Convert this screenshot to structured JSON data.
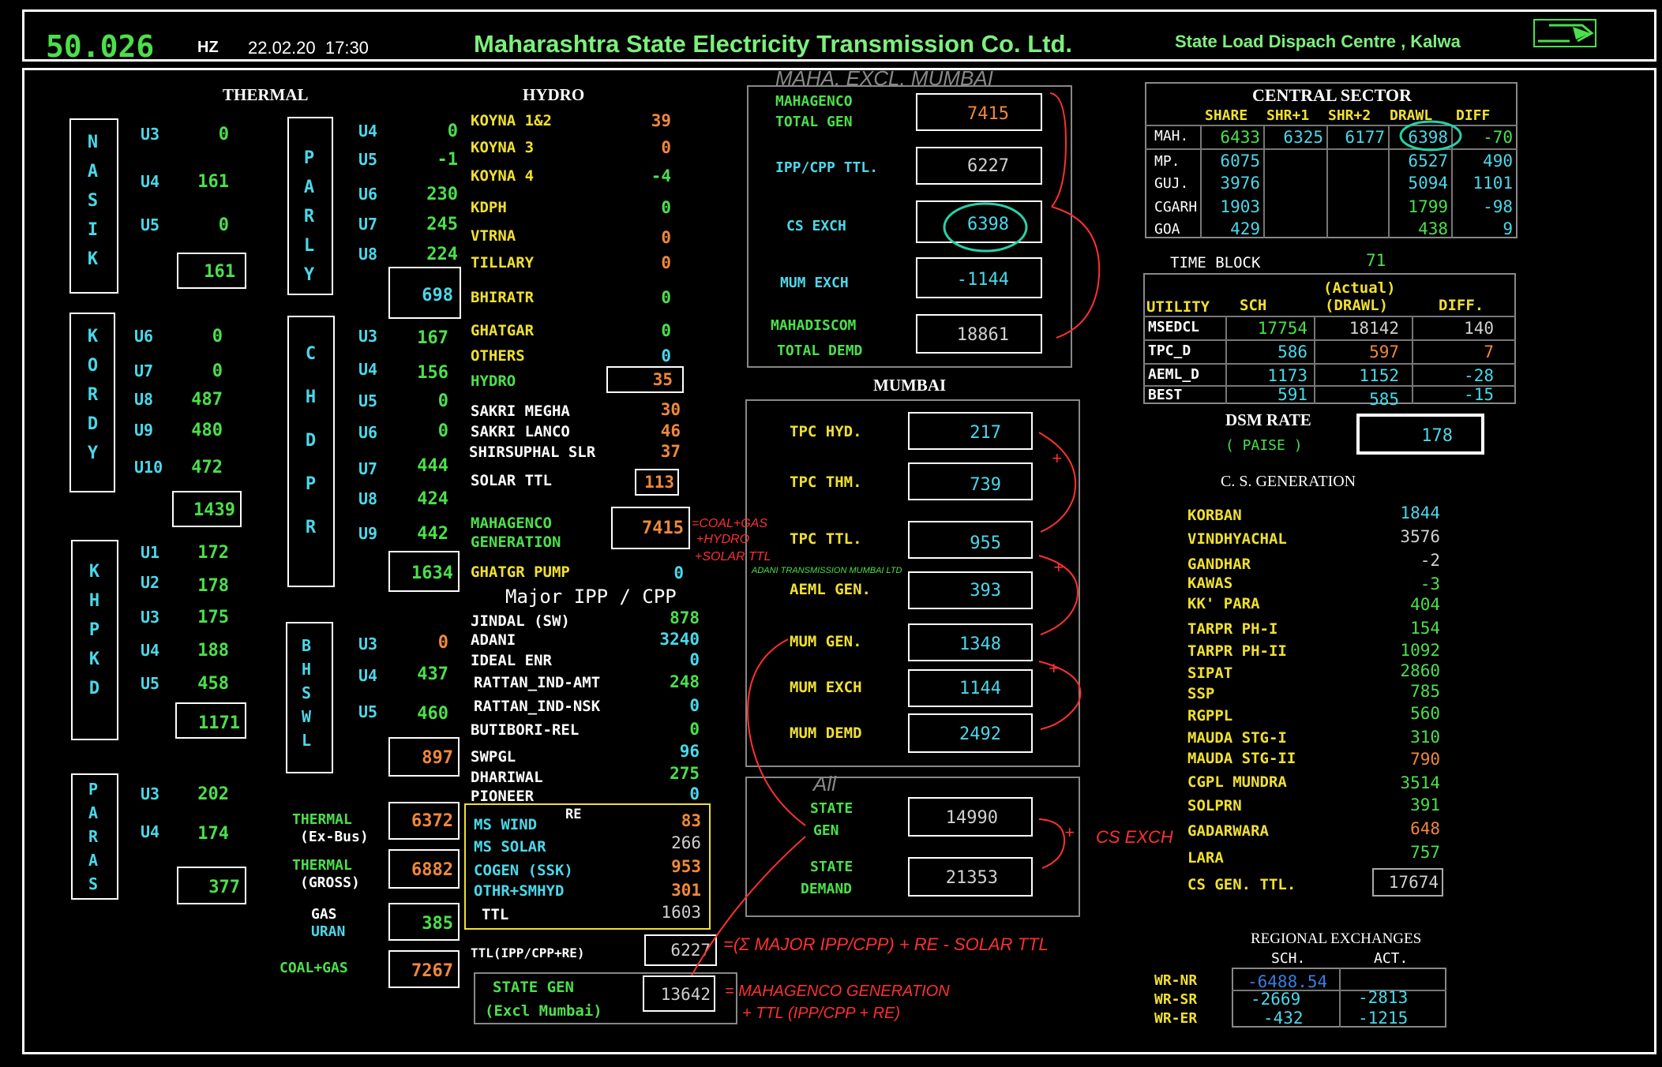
{
  "header": {
    "freq": "50.026",
    "freq_unit": "HZ",
    "datetime": "22.02.20  17:30",
    "company": "Maharashtra State Electricity Transmission Co. Ltd.",
    "centre": "State Load Dispach Centre , Kalwa"
  },
  "thermal": {
    "title": "THERMAL",
    "nasik": {
      "name": "NASIK",
      "units": [
        {
          "u": "U3",
          "v": "0"
        },
        {
          "u": "U4",
          "v": "161"
        },
        {
          "u": "U5",
          "v": "0"
        }
      ],
      "total": "161"
    },
    "koradi": {
      "name": "KORDY",
      "units": [
        {
          "u": "U6",
          "v": "0"
        },
        {
          "u": "U7",
          "v": "0"
        },
        {
          "u": "U8",
          "v": "487"
        },
        {
          "u": "U9",
          "v": "480"
        },
        {
          "u": "U10",
          "v": "472"
        }
      ],
      "total": "1439"
    },
    "khaperkheda": {
      "name": "KHPKD",
      "units": [
        {
          "u": "U1",
          "v": "172"
        },
        {
          "u": "U2",
          "v": "178"
        },
        {
          "u": "U3",
          "v": "175"
        },
        {
          "u": "U4",
          "v": "188"
        },
        {
          "u": "U5",
          "v": "458"
        }
      ],
      "total": "1171"
    },
    "paras": {
      "name": "PARAS",
      "units": [
        {
          "u": "U3",
          "v": "202"
        },
        {
          "u": "U4",
          "v": "174"
        }
      ],
      "total": "377"
    },
    "parly": {
      "name": "PARLY",
      "units": [
        {
          "u": "U4",
          "v": "0"
        },
        {
          "u": "U5",
          "v": "-1"
        },
        {
          "u": "U6",
          "v": "230"
        },
        {
          "u": "U7",
          "v": "245"
        },
        {
          "u": "U8",
          "v": "224"
        }
      ],
      "total": "698"
    },
    "chandrapur": {
      "name": "CHDPR",
      "units": [
        {
          "u": "U3",
          "v": "167"
        },
        {
          "u": "U4",
          "v": "156"
        },
        {
          "u": "U5",
          "v": "0"
        },
        {
          "u": "U6",
          "v": "0"
        },
        {
          "u": "U7",
          "v": "444"
        },
        {
          "u": "U8",
          "v": "424"
        },
        {
          "u": "U9",
          "v": "442"
        }
      ],
      "total": "1634"
    },
    "bhusawal": {
      "name": "BHSWL",
      "units": [
        {
          "u": "U3",
          "v": "0"
        },
        {
          "u": "U4",
          "v": "437"
        },
        {
          "u": "U5",
          "v": "460"
        }
      ],
      "total": "897"
    },
    "ex_bus_l1": "THERMAL",
    "ex_bus_l2": "(Ex-Bus)",
    "ex_bus": "6372",
    "gross_l1": "THERMAL",
    "gross_l2": "(GROSS)",
    "gross": "6882",
    "gas_l1": "GAS",
    "gas_l2": "URAN",
    "gas": "385",
    "coalgas_l": "COAL+GAS",
    "coalgas": "7267"
  },
  "hydro": {
    "title": "HYDRO",
    "rows": [
      {
        "n": "KOYNA 1&2",
        "v": "39"
      },
      {
        "n": "KOYNA 3",
        "v": "0"
      },
      {
        "n": "KOYNA 4",
        "v": "-4"
      },
      {
        "n": "KDPH",
        "v": "0"
      },
      {
        "n": "VTRNA",
        "v": "0"
      },
      {
        "n": "TILLARY",
        "v": "0"
      },
      {
        "n": "BHIRATR",
        "v": "0"
      },
      {
        "n": "GHATGAR",
        "v": "0"
      },
      {
        "n": "OTHERS",
        "v": "0"
      }
    ],
    "total_l": "HYDRO",
    "total": "35",
    "solar": [
      {
        "n": "SAKRI MEGHA",
        "v": "30"
      },
      {
        "n": "SAKRI LANCO",
        "v": "46"
      },
      {
        "n": "SHIRSUPHAL SLR",
        "v": "37"
      }
    ],
    "solar_ttl_l": "SOLAR TTL",
    "solar_ttl": "113",
    "mg_l1": "MAHAGENCO",
    "mg_l2": "GENERATION",
    "mg": "7415",
    "pump_l": "GHATGR PUMP",
    "pump": "0"
  },
  "ipp": {
    "title": "Major IPP / CPP",
    "rows": [
      {
        "n": "JINDAL (SW)",
        "v": "878"
      },
      {
        "n": "ADANI",
        "v": "3240"
      },
      {
        "n": "IDEAL ENR",
        "v": "0"
      },
      {
        "n": "RATTAN_IND-AMT",
        "v": "248"
      },
      {
        "n": "RATTAN_IND-NSK",
        "v": "0"
      },
      {
        "n": "BUTIBORI-REL",
        "v": "0"
      },
      {
        "n": "SWPGL",
        "v": "96"
      },
      {
        "n": "DHARIWAL",
        "v": "275"
      },
      {
        "n": "PIONEER",
        "v": "0"
      }
    ]
  },
  "re": {
    "title": "RE",
    "rows": [
      {
        "n": "MS WIND",
        "v": "83"
      },
      {
        "n": "MS SOLAR",
        "v": "266"
      },
      {
        "n": "COGEN (SSK)",
        "v": "953"
      },
      {
        "n": "OTHR+SMHYD",
        "v": "301"
      }
    ],
    "ttl_l": "TTL",
    "ttl": "1603"
  },
  "ttl_ipp": {
    "l": "TTL(IPP/CPP+RE)",
    "v": "6227"
  },
  "state_gen_excl": {
    "l1": "STATE GEN",
    "l2": "(Excl Mumbai)",
    "v": "13642"
  },
  "maha": {
    "rows": [
      {
        "l1": "MAHAGENCO",
        "l2": "TOTAL GEN",
        "v": "7415"
      },
      {
        "l1": "IPP/CPP TTL.",
        "l2": "",
        "v": "6227"
      },
      {
        "l1": "CS EXCH",
        "l2": "",
        "v": "6398"
      },
      {
        "l1": "MUM EXCH",
        "l2": "",
        "v": "-1144"
      },
      {
        "l1": "MAHADISCOM",
        "l2": "TOTAL DEMD",
        "v": "18861"
      }
    ]
  },
  "mumbai": {
    "title": "MUMBAI",
    "rows": [
      {
        "l": "TPC HYD.",
        "v": "217"
      },
      {
        "l": "TPC THM.",
        "v": "739"
      },
      {
        "l": "TPC TTL.",
        "v": "955"
      },
      {
        "l": "AEML GEN.",
        "v": "393"
      },
      {
        "l": "MUM GEN.",
        "v": "1348"
      },
      {
        "l": "MUM EXCH",
        "v": "1144"
      },
      {
        "l": "MUM DEMD",
        "v": "2492"
      }
    ]
  },
  "state": {
    "gen_l1": "STATE",
    "gen_l2": "GEN",
    "gen": "14990",
    "dem_l1": "STATE",
    "dem_l2": "DEMAND",
    "dem": "21353"
  },
  "central": {
    "title": "CENTRAL SECTOR",
    "cols": [
      "SHARE",
      "SHR+1",
      "SHR+2",
      "DRAWL",
      "DIFF"
    ],
    "rows": [
      {
        "n": "MAH.",
        "share": "6433",
        "s1": "6325",
        "s2": "6177",
        "drawl": "6398",
        "diff": "-70"
      },
      {
        "n": "MP.",
        "share": "6075",
        "s1": "",
        "s2": "",
        "drawl": "6527",
        "diff": "490"
      },
      {
        "n": "GUJ.",
        "share": "3976",
        "s1": "",
        "s2": "",
        "drawl": "5094",
        "diff": "1101"
      },
      {
        "n": "CGARH",
        "share": "1903",
        "s1": "",
        "s2": "",
        "drawl": "1799",
        "diff": "-98"
      },
      {
        "n": "GOA",
        "share": "429",
        "s1": "",
        "s2": "",
        "drawl": "438",
        "diff": "9"
      }
    ]
  },
  "timeblock": {
    "l": "TIME BLOCK",
    "v": "71"
  },
  "utility": {
    "cols": [
      "UTILITY",
      "SCH",
      "(Actual)",
      "(DRAWL)",
      "DIFF."
    ],
    "rows": [
      {
        "n": "MSEDCL",
        "sch": "17754",
        "act": "18142",
        "diff": "140"
      },
      {
        "n": "TPC_D",
        "sch": "586",
        "act": "597",
        "diff": "7"
      },
      {
        "n": "AEML_D",
        "sch": "1173",
        "act": "1152",
        "diff": "-28"
      },
      {
        "n": "BEST",
        "sch": "591",
        "act": "585",
        "diff": "-15"
      }
    ]
  },
  "dsm": {
    "l1": "DSM RATE",
    "l2": "( PAISE )",
    "v": "178"
  },
  "csgen": {
    "title": "C. S. GENERATION",
    "rows": [
      {
        "n": "KORBAN",
        "v": "1844"
      },
      {
        "n": "VINDHYACHAL",
        "v": "3576"
      },
      {
        "n": "GANDHAR",
        "v": "-2"
      },
      {
        "n": "KAWAS",
        "v": "-3"
      },
      {
        "n": "KK' PARA",
        "v": "404"
      },
      {
        "n": "TARPR PH-I",
        "v": "154"
      },
      {
        "n": "TARPR PH-II",
        "v": "1092"
      },
      {
        "n": "SIPAT",
        "v": "2860"
      },
      {
        "n": "SSP",
        "v": "785"
      },
      {
        "n": "RGPPL",
        "v": "560"
      },
      {
        "n": "MAUDA STG-I",
        "v": "310"
      },
      {
        "n": "MAUDA STG-II",
        "v": "790"
      },
      {
        "n": "CGPL MUNDRA",
        "v": "3514"
      },
      {
        "n": "SOLPRN",
        "v": "391"
      },
      {
        "n": "GADARWARA",
        "v": "648"
      },
      {
        "n": "LARA",
        "v": "757"
      }
    ],
    "ttl_l": "CS GEN. TTL.",
    "ttl": "17674"
  },
  "regional": {
    "title": "REGIONAL EXCHANGES",
    "cols": [
      "SCH.",
      "ACT."
    ],
    "rows": [
      {
        "n": "WR-NR",
        "sch": "-6488.54",
        "act": ""
      },
      {
        "n": "WR-SR",
        "sch": "-2669",
        "act": "-2813"
      },
      {
        "n": "WR-ER",
        "sch": "-432",
        "act": "-1215"
      }
    ]
  },
  "notes": {
    "maha_excl": "MAHA. EXCL. MUMBAI",
    "coalgas": "=COAL+GAS",
    "hydro": "+HYDRO",
    "solar": "+SOLAR TTL",
    "adani": "ADANI TRANSMISSION MUMBAI LTD",
    "all": "All",
    "cs_exch": "CS EXCH",
    "ttl_formula": "=(Σ MAJOR IPP/CPP) + RE - SOLAR TTL",
    "sg_formula1": "= MAHAGENCO GENERATION",
    "sg_formula2": "+ TTL (IPP/CPP + RE)",
    "plus": "+"
  },
  "colors": {
    "green": "#4be04b",
    "cyan": "#4ad8ea",
    "yellow": "#f0e030",
    "orange": "#f0883a",
    "red": "#ff3030",
    "white": "#ffffff"
  }
}
